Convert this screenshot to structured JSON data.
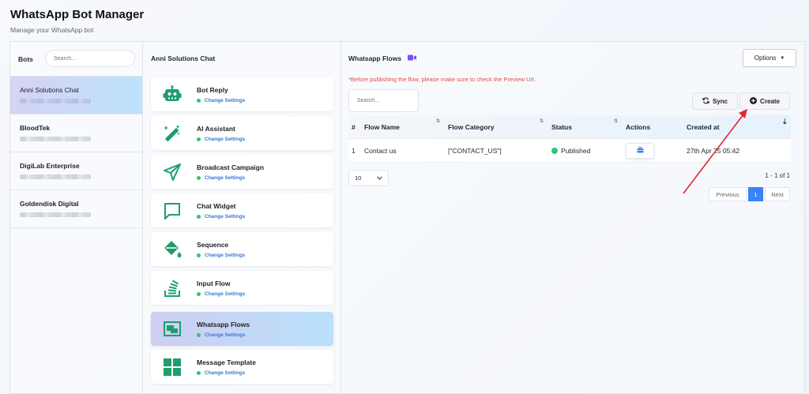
{
  "app": {
    "title": "WhatsApp Bot Manager",
    "subtitle": "Manage your WhatsApp bot"
  },
  "bots": {
    "title": "Bots",
    "search_placeholder": "Search...",
    "items": [
      {
        "name": "Anni Solutions Chat",
        "active": true
      },
      {
        "name": "BloodTek",
        "active": false
      },
      {
        "name": "DigiLab Enterprise",
        "active": false
      },
      {
        "name": "Goldendisk Digital",
        "active": false
      }
    ]
  },
  "features": {
    "title": "Anni Solutions Chat",
    "link_label": "Change Settings",
    "items": [
      {
        "name": "Bot Reply",
        "icon": "robot-icon"
      },
      {
        "name": "AI Assistant",
        "icon": "magic-wand-icon"
      },
      {
        "name": "Broadcast Campaign",
        "icon": "paper-plane-icon"
      },
      {
        "name": "Chat Widget",
        "icon": "chat-bubble-icon"
      },
      {
        "name": "Sequence",
        "icon": "paint-bucket-icon"
      },
      {
        "name": "Input Flow",
        "icon": "stack-icon"
      },
      {
        "name": "Whatsapp Flows",
        "icon": "flows-icon",
        "active": true
      },
      {
        "name": "Message Template",
        "icon": "template-grid-icon"
      }
    ]
  },
  "main": {
    "title": "Whatsapp Flows",
    "title_icon": "video-icon",
    "options_label": "Options",
    "warning": "*Before publishing the flow, please make sure to check the Preview Url.",
    "search_placeholder": "Search...",
    "sync_label": "Sync",
    "create_label": "Create",
    "table": {
      "headers": [
        "#",
        "Flow Name",
        "Flow Category",
        "Status",
        "Actions",
        "Created at"
      ],
      "rows": [
        {
          "num": "1",
          "name": "Contact us",
          "category": "[\"CONTACT_US\"]",
          "status": "Published",
          "created": "27th Apr 25 05:42"
        }
      ]
    },
    "page_size": "10",
    "range_text": "1 - 1 of 1",
    "pagination": {
      "prev": "Previous",
      "current": "1",
      "next": "Next"
    }
  },
  "colors": {
    "accent": "#3b82f6",
    "success": "#33c27a",
    "warning": "#e5484d",
    "icon_green": "#1e9e6a",
    "annotation": "#e0282e"
  }
}
